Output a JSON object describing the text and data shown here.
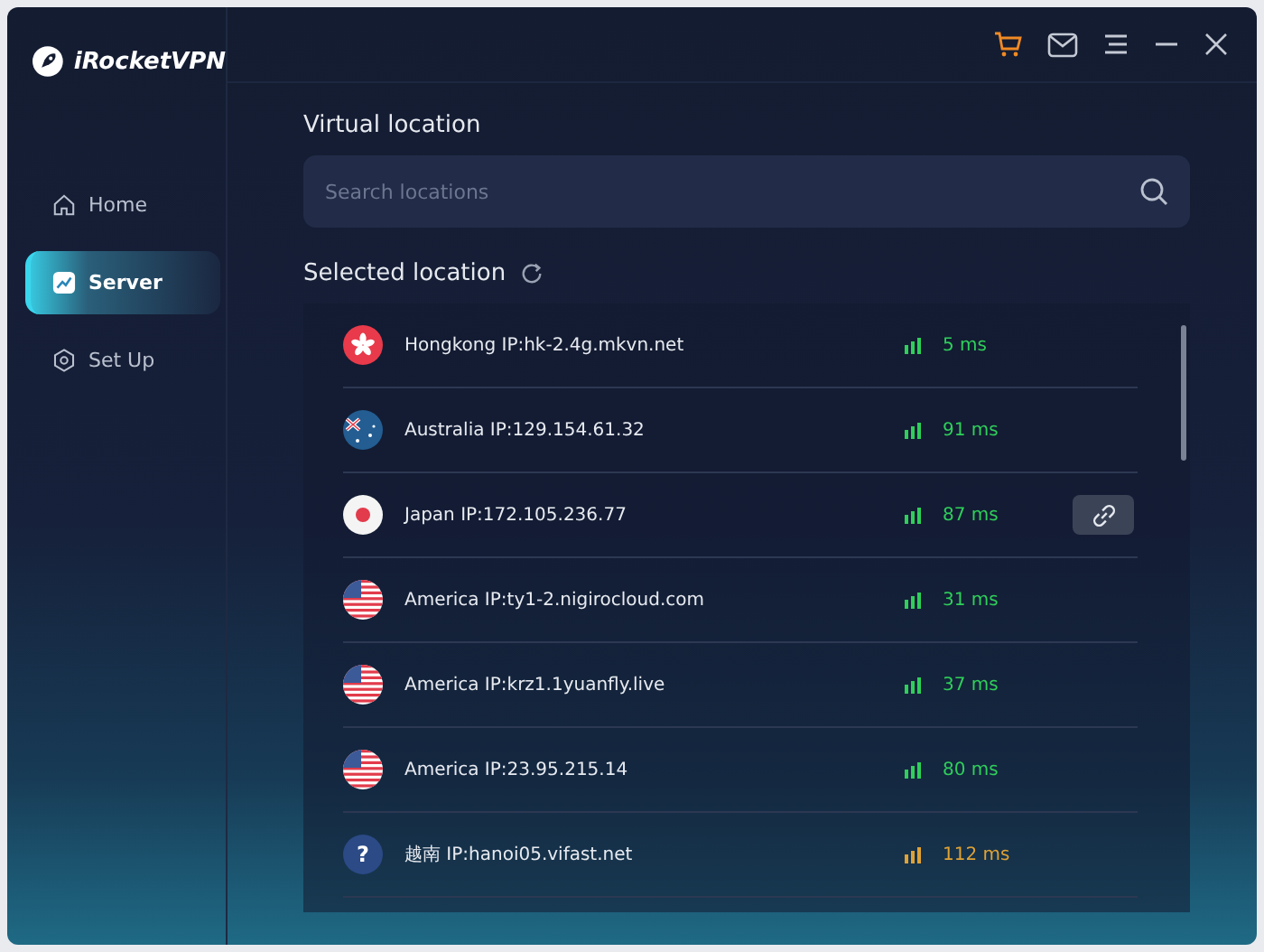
{
  "app": {
    "name": "iRocketVPN"
  },
  "nav": [
    {
      "label": "Home",
      "selected": false
    },
    {
      "label": "Server",
      "selected": true
    },
    {
      "label": "Set Up",
      "selected": false
    }
  ],
  "virtual_location": {
    "title": "Virtual location",
    "search": {
      "placeholder": "Search locations"
    }
  },
  "selected_location": {
    "title": "Selected location"
  },
  "servers": [
    {
      "kind": "hk",
      "name": "Hongkong IP:hk-2.4g.mkvn.net",
      "ping": "5 ms",
      "color": "#2fcf5a",
      "selected": false
    },
    {
      "kind": "au",
      "name": "Australia IP:129.154.61.32",
      "ping": "91 ms",
      "color": "#2fcf5a",
      "selected": false
    },
    {
      "kind": "jp",
      "name": "Japan IP:172.105.236.77",
      "ping": "87 ms",
      "color": "#2fcf5a",
      "selected": true
    },
    {
      "kind": "us",
      "name": "America IP:ty1-2.nigirocloud.com",
      "ping": "31 ms",
      "color": "#2fcf5a",
      "selected": false
    },
    {
      "kind": "us",
      "name": "America IP:krz1.1yuanfly.live",
      "ping": "37 ms",
      "color": "#2fcf5a",
      "selected": false
    },
    {
      "kind": "us",
      "name": "America IP:23.95.215.14",
      "ping": "80 ms",
      "color": "#2fcf5a",
      "selected": false
    },
    {
      "kind": "unknown",
      "flag_label": "?",
      "name": "越南 IP:hanoi05.vifast.net",
      "ping": "112 ms",
      "color": "#e0a234",
      "selected": false
    }
  ]
}
